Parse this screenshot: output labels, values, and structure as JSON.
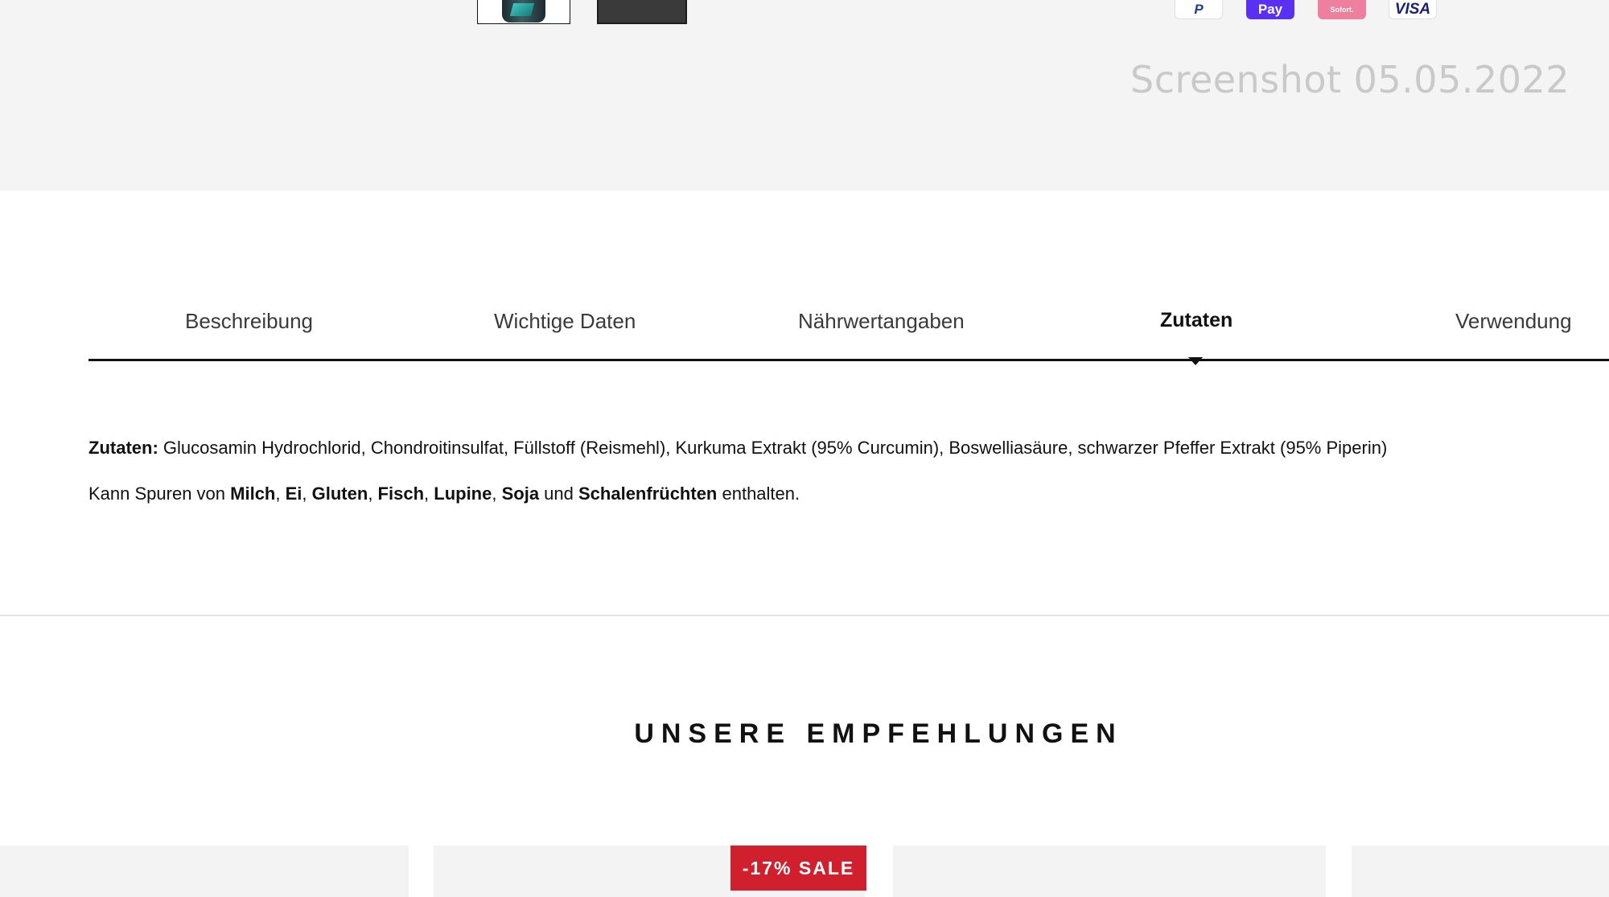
{
  "watermark": "Screenshot 05.05.2022",
  "payment_methods": [
    "P",
    "Pay",
    "Sofort.",
    "VISA"
  ],
  "tabs": [
    {
      "label": "Beschreibung",
      "active": false
    },
    {
      "label": "Wichtige Daten",
      "active": false
    },
    {
      "label": "Nährwertangaben",
      "active": false
    },
    {
      "label": "Zutaten",
      "active": true
    },
    {
      "label": "Verwendung",
      "active": false
    }
  ],
  "ingredients": {
    "label": "Zutaten:",
    "text": " Glucosamin Hydrochlorid, Chondroitinsulfat, Füllstoff (Reismehl), Kurkuma Extrakt (95% Curcumin), Boswelliasäure, schwarzer Pfeffer Extrakt (95% Piperin)"
  },
  "allergens": {
    "prefix": "Kann Spuren von ",
    "items": [
      "Milch",
      "Ei",
      "Gluten",
      "Fisch",
      "Lupine",
      "Soja"
    ],
    "sep": ", ",
    "and": " und ",
    "last": "Schalenfrüchten",
    "suffix": " enthalten."
  },
  "recommendations": {
    "title": "UNSERE EMPFEHLUNGEN",
    "sale_badge": "-17% SALE"
  },
  "colors": {
    "sale": "#d0202e",
    "band": "#f4f4f4"
  }
}
